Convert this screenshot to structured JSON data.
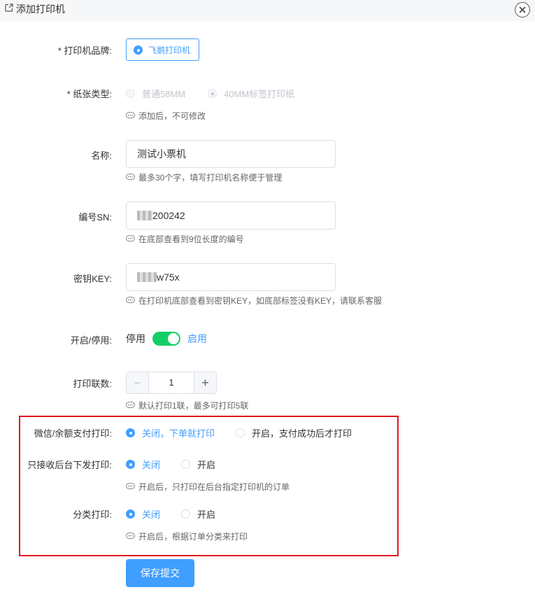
{
  "window": {
    "title": "添加打印机"
  },
  "form": {
    "brand": {
      "label": "* 打印机品牌:",
      "option": "飞鹅打印机"
    },
    "paper": {
      "label": "* 纸张类型:",
      "options": [
        "普通58MM",
        "40MM标签打印纸"
      ],
      "hint": "添加后，不可修改"
    },
    "name": {
      "label": "名称:",
      "value": "测试小票机",
      "hint": "最多30个字，填写打印机名称便于管理"
    },
    "sn": {
      "label": "编号SN:",
      "value_visible": "200242",
      "hint": "在底部查看到9位长度的编号"
    },
    "key": {
      "label": "密钥KEY:",
      "value_visible": "w75x",
      "hint": "在打印机底部查看到密钥KEY，如底部标签没有KEY，请联系客服"
    },
    "enable": {
      "label": "开启/停用:",
      "off_text": "停用",
      "on_text": "启用",
      "state": "on"
    },
    "copies": {
      "label": "打印联数:",
      "minus": "−",
      "value": "1",
      "plus": "+",
      "hint": "默认打印1联，最多可打印5联"
    },
    "wechat_pay": {
      "label": "微信/余额支付打印:",
      "options": [
        "关闭，下单就打印",
        "开启，支付成功后才打印"
      ],
      "selected": 0
    },
    "backend_only": {
      "label": "只接收后台下发打印:",
      "options": [
        "关闭",
        "开启"
      ],
      "selected": 0,
      "hint": "开启后，只打印在后台指定打印机的订单"
    },
    "category_print": {
      "label": "分类打印:",
      "options": [
        "关闭",
        "开启"
      ],
      "selected": 0,
      "hint": "开启后，根据订单分类来打印"
    },
    "submit_label": "保存提交"
  },
  "colors": {
    "accent": "#409eff",
    "switch_on": "#13ce66",
    "highlight_border": "#e0161e"
  },
  "icons": {
    "title": "external-link-icon",
    "close": "close-icon",
    "hint": "speech-bubble-icon"
  }
}
